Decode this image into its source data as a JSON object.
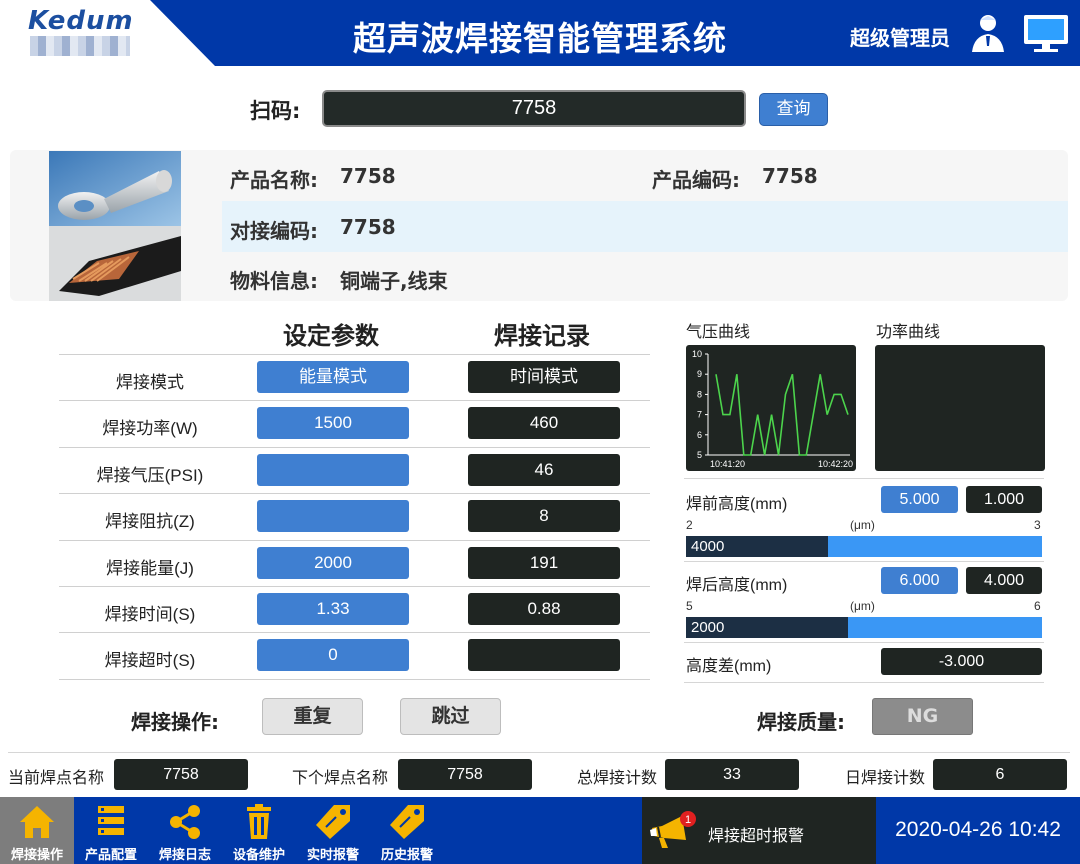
{
  "header": {
    "logo_text": "Kedum",
    "title": "超声波焊接智能管理系统",
    "user_role": "超级管理员",
    "user_icon": "user-icon",
    "monitor_icon": "monitor-icon"
  },
  "scan": {
    "label": "扫码:",
    "value": "7758",
    "query_label": "查询"
  },
  "product": {
    "name_label": "产品名称:",
    "name_value": "7758",
    "code_label": "产品编码:",
    "code_value": "7758",
    "butt_code_label": "对接编码:",
    "butt_code_value": "7758",
    "material_label": "物料信息:",
    "material_value": "铜端子,线束"
  },
  "params": {
    "set_title": "设定参数",
    "record_title": "焊接记录",
    "rows": [
      {
        "label": "焊接模式",
        "set": "能量模式",
        "record": "时间模式"
      },
      {
        "label": "焊接功率(W)",
        "set": "1500",
        "record": "460"
      },
      {
        "label": "焊接气压(PSI)",
        "set": "",
        "record": "46"
      },
      {
        "label": "焊接阻抗(Z)",
        "set": "",
        "record": "8"
      },
      {
        "label": "焊接能量(J)",
        "set": "2000",
        "record": "191"
      },
      {
        "label": "焊接时间(S)",
        "set": "1.33",
        "record": "0.88"
      },
      {
        "label": "焊接超时(S)",
        "set": "0",
        "record": ""
      }
    ]
  },
  "charts": {
    "pressure_label": "气压曲线",
    "power_label": "功率曲线"
  },
  "chart_data": {
    "type": "line",
    "title": "气压曲线",
    "x_tick_labels": [
      "10:41:20",
      "10:42:20"
    ],
    "y_ticks": [
      5,
      6,
      7,
      8,
      9,
      10
    ],
    "ylim": [
      5,
      10
    ],
    "series": [
      {
        "values": [
          9,
          7,
          7,
          9,
          5,
          5,
          7,
          5,
          7,
          5,
          8,
          9,
          5,
          5,
          7,
          9,
          7,
          8,
          8,
          7
        ],
        "color": "#4cd44c"
      }
    ]
  },
  "heights": {
    "before_label": "焊前高度(mm)",
    "before_set": "5.000",
    "before_actual": "1.000",
    "before_scale_min": "2",
    "before_scale_unit": "(μm)",
    "before_scale_max": "3",
    "before_bar_value": "4000",
    "before_bar_fraction": 0.4,
    "after_label": "焊后高度(mm)",
    "after_set": "6.000",
    "after_actual": "4.000",
    "after_scale_min": "5",
    "after_scale_unit": "(μm)",
    "after_scale_max": "6",
    "after_bar_value": "2000",
    "after_bar_fraction": 0.455,
    "diff_label": "高度差(mm)",
    "diff_value": "-3.000"
  },
  "operations": {
    "label": "焊接操作:",
    "repeat_label": "重复",
    "skip_label": "跳过",
    "quality_label": "焊接质量:",
    "quality_value": "NG"
  },
  "counters": {
    "current_label": "当前焊点名称",
    "current_value": "7758",
    "next_label": "下个焊点名称",
    "next_value": "7758",
    "total_label": "总焊接计数",
    "total_value": "33",
    "daily_label": "日焊接计数",
    "daily_value": "6"
  },
  "nav": {
    "items": [
      {
        "label": "焊接操作",
        "icon": "home-icon"
      },
      {
        "label": "产品配置",
        "icon": "list-icon"
      },
      {
        "label": "焊接日志",
        "icon": "share-icon"
      },
      {
        "label": "设备维护",
        "icon": "trash-icon"
      },
      {
        "label": "实时报警",
        "icon": "tag-icon"
      },
      {
        "label": "历史报警",
        "icon": "tag-icon"
      }
    ],
    "alarm_text": "焊接超时报警",
    "alarm_badge": "1",
    "datetime": "2020-04-26 10:42"
  },
  "colors": {
    "header_blue": "#0038a8",
    "accent_blue": "#3f7fd1",
    "dark_cell": "#1f2522",
    "chart_line": "#4cd44c",
    "icon_yellow": "#f5b400"
  }
}
